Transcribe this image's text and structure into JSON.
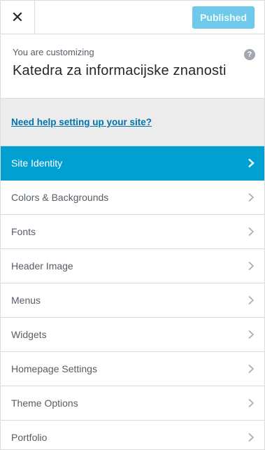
{
  "header": {
    "close_glyph": "✕",
    "publish_label": "Published"
  },
  "info": {
    "label": "You are customizing",
    "site_name": "Katedra za informacijske znanosti",
    "help_glyph": "?"
  },
  "help": {
    "link_text": "Need help setting up your site?"
  },
  "menu": {
    "items": [
      {
        "label": "Site Identity",
        "active": true
      },
      {
        "label": "Colors & Backgrounds",
        "active": false
      },
      {
        "label": "Fonts",
        "active": false
      },
      {
        "label": "Header Image",
        "active": false
      },
      {
        "label": "Menus",
        "active": false
      },
      {
        "label": "Widgets",
        "active": false
      },
      {
        "label": "Homepage Settings",
        "active": false
      },
      {
        "label": "Theme Options",
        "active": false
      },
      {
        "label": "Portfolio",
        "active": false
      }
    ]
  },
  "colors": {
    "accent": "#00a0d2",
    "publish_button": "#6ec9ea",
    "link": "#0073aa"
  }
}
